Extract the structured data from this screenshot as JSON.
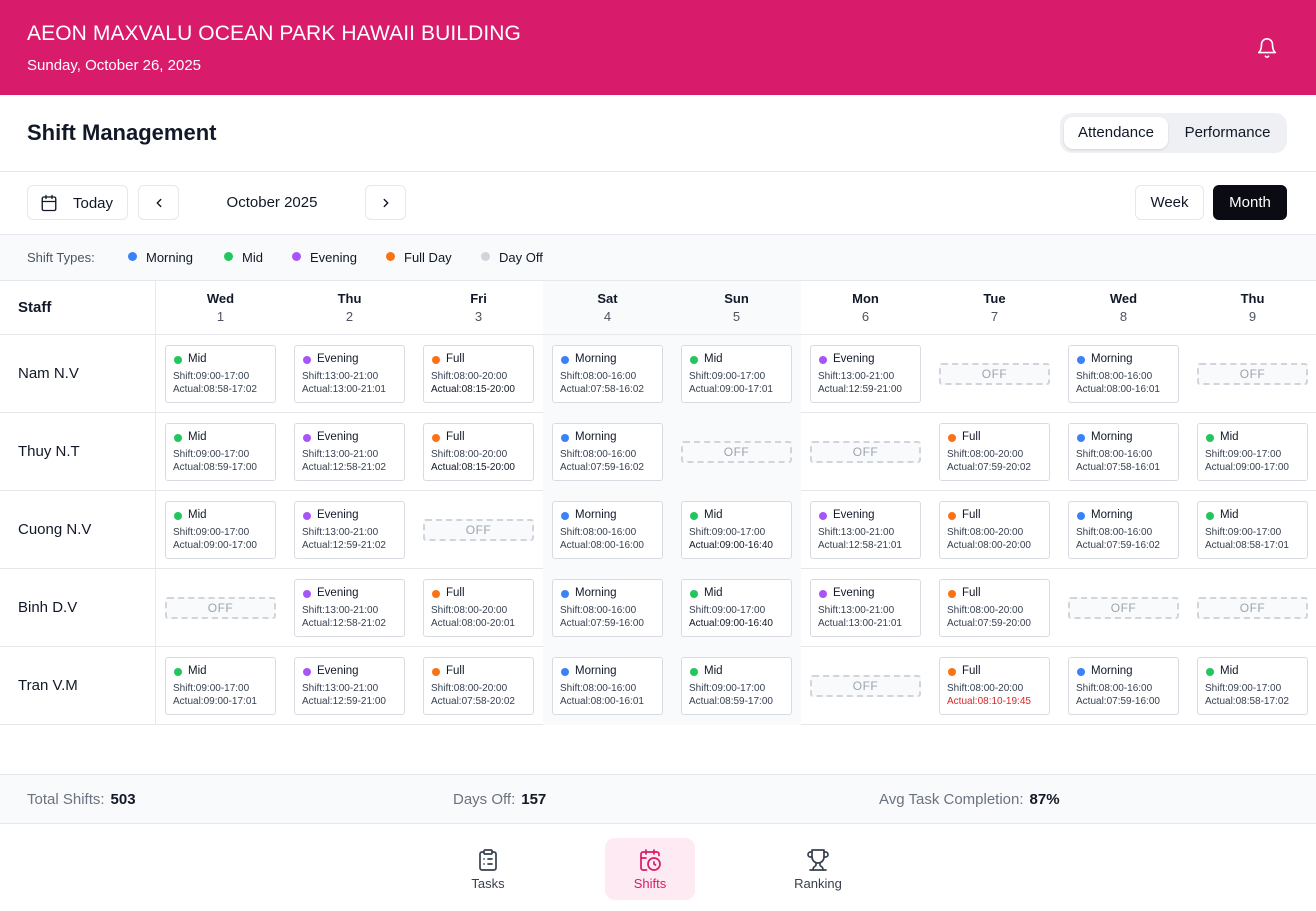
{
  "header": {
    "store_name": "AEON MAXVALU OCEAN PARK HAWAII BUILDING",
    "date": "Sunday, October 26, 2025",
    "notification_icon": "bell-icon"
  },
  "page": {
    "title": "Shift Management",
    "view_tabs": [
      "Attendance",
      "Performance"
    ],
    "active_view_tab": "Attendance"
  },
  "toolbar": {
    "today_label": "Today",
    "period_label": "October 2025",
    "week_label": "Week",
    "month_label": "Month",
    "active_range": "Month"
  },
  "legend": {
    "title": "Shift Types:",
    "items": [
      {
        "label": "Morning",
        "color": "#3b82f6"
      },
      {
        "label": "Mid",
        "color": "#22c55e"
      },
      {
        "label": "Evening",
        "color": "#a855f7"
      },
      {
        "label": "Full Day",
        "color": "#f97316"
      },
      {
        "label": "Day Off",
        "color": "#d1d5db"
      }
    ]
  },
  "schedule": {
    "staff_header": "Staff",
    "days": [
      {
        "dow": "Wed",
        "date": "1",
        "weekend": false
      },
      {
        "dow": "Thu",
        "date": "2",
        "weekend": false
      },
      {
        "dow": "Fri",
        "date": "3",
        "weekend": false
      },
      {
        "dow": "Sat",
        "date": "4",
        "weekend": true
      },
      {
        "dow": "Sun",
        "date": "5",
        "weekend": true
      },
      {
        "dow": "Mon",
        "date": "6",
        "weekend": false
      },
      {
        "dow": "Tue",
        "date": "7",
        "weekend": false
      },
      {
        "dow": "Wed",
        "date": "8",
        "weekend": false
      },
      {
        "dow": "Thu",
        "date": "9",
        "weekend": false
      }
    ],
    "rows": [
      {
        "name": "Nam N.V",
        "cells": [
          {
            "type": "Mid",
            "shift": "Shift:09:00-17:00",
            "actual": "Actual:08:58-17:02"
          },
          {
            "type": "Evening",
            "shift": "Shift:13:00-21:00",
            "actual": "Actual:13:00-21:01"
          },
          {
            "type": "Full",
            "shift": "Shift:08:00-20:00",
            "actual": "Actual:08:15-20:00",
            "status": "ok"
          },
          {
            "type": "Morning",
            "shift": "Shift:08:00-16:00",
            "actual": "Actual:07:58-16:02"
          },
          {
            "type": "Mid",
            "shift": "Shift:09:00-17:00",
            "actual": "Actual:09:00-17:01"
          },
          {
            "type": "Evening",
            "shift": "Shift:13:00-21:00",
            "actual": "Actual:12:59-21:00"
          },
          {
            "off": "OFF"
          },
          {
            "type": "Morning",
            "shift": "Shift:08:00-16:00",
            "actual": "Actual:08:00-16:01"
          },
          {
            "off": "OFF"
          }
        ]
      },
      {
        "name": "Thuy N.T",
        "cells": [
          {
            "type": "Mid",
            "shift": "Shift:09:00-17:00",
            "actual": "Actual:08:59-17:00"
          },
          {
            "type": "Evening",
            "shift": "Shift:13:00-21:00",
            "actual": "Actual:12:58-21:02"
          },
          {
            "type": "Full",
            "shift": "Shift:08:00-20:00",
            "actual": "Actual:08:15-20:00",
            "status": "ok"
          },
          {
            "type": "Morning",
            "shift": "Shift:08:00-16:00",
            "actual": "Actual:07:59-16:02"
          },
          {
            "off": "OFF"
          },
          {
            "off": "OFF"
          },
          {
            "type": "Full",
            "shift": "Shift:08:00-20:00",
            "actual": "Actual:07:59-20:02"
          },
          {
            "type": "Morning",
            "shift": "Shift:08:00-16:00",
            "actual": "Actual:07:58-16:01"
          },
          {
            "type": "Mid",
            "shift": "Shift:09:00-17:00",
            "actual": "Actual:09:00-17:00"
          }
        ]
      },
      {
        "name": "Cuong N.V",
        "cells": [
          {
            "type": "Mid",
            "shift": "Shift:09:00-17:00",
            "actual": "Actual:09:00-17:00"
          },
          {
            "type": "Evening",
            "shift": "Shift:13:00-21:00",
            "actual": "Actual:12:59-21:02"
          },
          {
            "off": "OFF"
          },
          {
            "type": "Morning",
            "shift": "Shift:08:00-16:00",
            "actual": "Actual:08:00-16:00"
          },
          {
            "type": "Mid",
            "shift": "Shift:09:00-17:00",
            "actual": "Actual:09:00-16:40",
            "status": "ok"
          },
          {
            "type": "Evening",
            "shift": "Shift:13:00-21:00",
            "actual": "Actual:12:58-21:01"
          },
          {
            "type": "Full",
            "shift": "Shift:08:00-20:00",
            "actual": "Actual:08:00-20:00"
          },
          {
            "type": "Morning",
            "shift": "Shift:08:00-16:00",
            "actual": "Actual:07:59-16:02"
          },
          {
            "type": "Mid",
            "shift": "Shift:09:00-17:00",
            "actual": "Actual:08:58-17:01"
          }
        ]
      },
      {
        "name": "Binh D.V",
        "cells": [
          {
            "off": "OFF"
          },
          {
            "type": "Evening",
            "shift": "Shift:13:00-21:00",
            "actual": "Actual:12:58-21:02"
          },
          {
            "type": "Full",
            "shift": "Shift:08:00-20:00",
            "actual": "Actual:08:00-20:01"
          },
          {
            "type": "Morning",
            "shift": "Shift:08:00-16:00",
            "actual": "Actual:07:59-16:00"
          },
          {
            "type": "Mid",
            "shift": "Shift:09:00-17:00",
            "actual": "Actual:09:00-16:40",
            "status": "ok"
          },
          {
            "type": "Evening",
            "shift": "Shift:13:00-21:00",
            "actual": "Actual:13:00-21:01"
          },
          {
            "type": "Full",
            "shift": "Shift:08:00-20:00",
            "actual": "Actual:07:59-20:00"
          },
          {
            "off": "OFF"
          },
          {
            "off": "OFF"
          }
        ]
      },
      {
        "name": "Tran V.M",
        "cells": [
          {
            "type": "Mid",
            "shift": "Shift:09:00-17:00",
            "actual": "Actual:09:00-17:01"
          },
          {
            "type": "Evening",
            "shift": "Shift:13:00-21:00",
            "actual": "Actual:12:59-21:00"
          },
          {
            "type": "Full",
            "shift": "Shift:08:00-20:00",
            "actual": "Actual:07:58-20:02"
          },
          {
            "type": "Morning",
            "shift": "Shift:08:00-16:00",
            "actual": "Actual:08:00-16:01"
          },
          {
            "type": "Mid",
            "shift": "Shift:09:00-17:00",
            "actual": "Actual:08:59-17:00"
          },
          {
            "off": "OFF"
          },
          {
            "type": "Full",
            "shift": "Shift:08:00-20:00",
            "actual": "Actual:08:10-19:45",
            "status": "late"
          },
          {
            "type": "Morning",
            "shift": "Shift:08:00-16:00",
            "actual": "Actual:07:59-16:00"
          },
          {
            "type": "Mid",
            "shift": "Shift:09:00-17:00",
            "actual": "Actual:08:58-17:02"
          }
        ]
      }
    ]
  },
  "stats": {
    "total_shifts_label": "Total Shifts:",
    "total_shifts_value": "503",
    "days_off_label": "Days Off:",
    "days_off_value": "157",
    "avg_task_label": "Avg Task Completion:",
    "avg_task_value": "87%"
  },
  "bottom_nav": [
    {
      "label": "Tasks",
      "icon": "clipboard-list-icon",
      "active": false
    },
    {
      "label": "Shifts",
      "icon": "calendar-clock-icon",
      "active": true
    },
    {
      "label": "Ranking",
      "icon": "trophy-icon",
      "active": false
    }
  ],
  "colors": {
    "brand": "#d81b6a",
    "Morning": "#3b82f6",
    "Mid": "#22c55e",
    "Evening": "#a855f7",
    "Full": "#f97316",
    "late": "#dc2626"
  }
}
